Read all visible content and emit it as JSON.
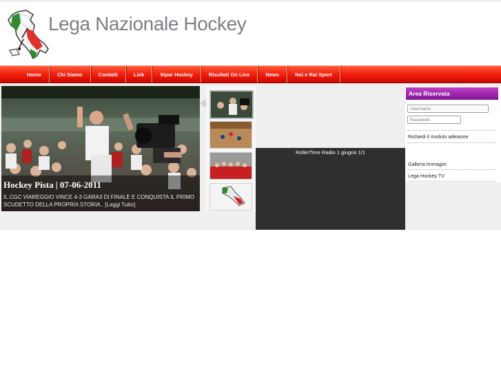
{
  "header": {
    "title": "Lega Nazionale Hockey"
  },
  "nav": {
    "items": [
      {
        "label": "Home"
      },
      {
        "label": "Chi Siamo"
      },
      {
        "label": "Contatti"
      },
      {
        "label": "Link"
      },
      {
        "label": "Sipar Hockey"
      },
      {
        "label": "Risultati On Line"
      },
      {
        "label": "News"
      },
      {
        "label": "Noi e Rai Sport"
      }
    ]
  },
  "feature": {
    "title": "Hockey Pista | 07-06-2011",
    "text": "IL CGC VIAREGGIO VINCE 4-3 GARA3 DI FINALE E CONQUISTA IL PRIMO SCUDETTO DELLA PROPRIA STORIA.. [Leggi Tutto]"
  },
  "video": {
    "title": "RollerTime Radio 1 giugno 1/1"
  },
  "sidebar": {
    "area_title": "Area Riservata",
    "username_placeholder": "Username",
    "password_placeholder": "Password",
    "request_link": "Richiedi il modulo adesione",
    "links": [
      {
        "label": "Galleria Immagini"
      },
      {
        "label": "Lega Hockey TV"
      }
    ]
  },
  "colors": {
    "nav_red": "#f01a0a",
    "area_purple": "#9a20a8",
    "title_gray": "#7b7f86"
  }
}
